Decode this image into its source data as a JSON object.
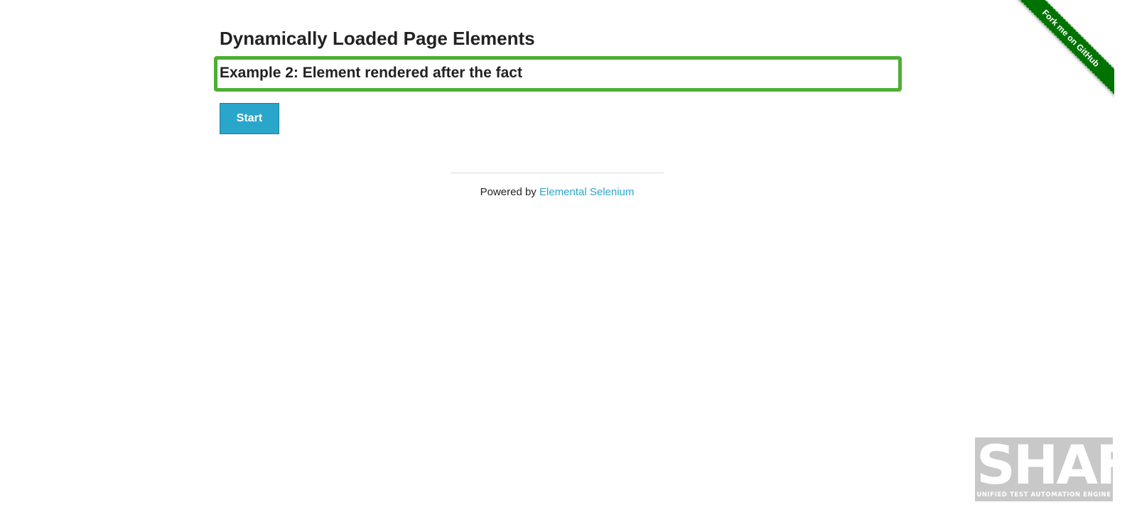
{
  "page": {
    "title": "Dynamically Loaded Page Elements",
    "example_heading": "Example 2: Element rendered after the fact",
    "start_button_label": "Start",
    "highlight_color": "#4caf35",
    "accent_color": "#2ba6cb"
  },
  "footer": {
    "powered_by_text": "Powered by ",
    "link_text": "Elemental Selenium"
  },
  "ribbon": {
    "text": "Fork me on GitHub",
    "color": "#007200"
  },
  "shaft_logo": {
    "title": "SHAFT",
    "subtitle": "UNIFIED TEST AUTOMATION ENGINE"
  }
}
